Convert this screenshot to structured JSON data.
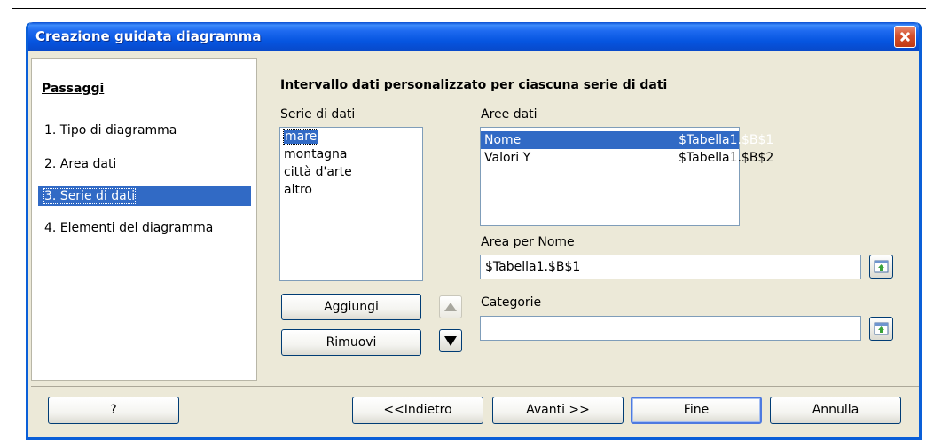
{
  "window": {
    "title": "Creazione guidata diagramma"
  },
  "steps": {
    "heading": "Passaggi",
    "items": [
      {
        "label": "1.  Tipo di diagramma",
        "active": false
      },
      {
        "label": "2.  Area dati",
        "active": false
      },
      {
        "label": "3.  Serie di dati",
        "active": true
      },
      {
        "label": "4.  Elementi del diagramma",
        "active": false
      }
    ]
  },
  "main": {
    "title": "Intervallo dati personalizzato per ciascuna serie di dati",
    "series_label": "Serie di dati",
    "series": [
      "mare",
      "montagna",
      "città d'arte",
      "altro"
    ],
    "selected_series": "mare",
    "ranges_label": "Aree dati",
    "ranges": [
      {
        "role": "Nome",
        "range": "$Tabella1.$B$1",
        "selected": true
      },
      {
        "role": "Valori Y",
        "range": "$Tabella1.$B$2",
        "selected": false
      }
    ],
    "range_for_name_label": "Area per Nome",
    "range_for_name_value": "$Tabella1.$B$1",
    "categories_label": "Categorie",
    "categories_value": "",
    "add_button": "Aggiungi",
    "remove_button": "Rimuovi"
  },
  "footer": {
    "help_button": "?",
    "back_button": "<<Indietro",
    "next_button": "Avanti >>",
    "finish_button": "Fine",
    "cancel_button": "Annulla"
  },
  "icons": {
    "move_up": "triangle-up-icon",
    "move_down": "triangle-down-icon",
    "shrink": "shrink-dialog-icon",
    "close": "close-icon"
  },
  "colors": {
    "title_bar": "#0a5fd8",
    "selection": "#316ac5",
    "dialog_bg": "#ece9d8"
  }
}
